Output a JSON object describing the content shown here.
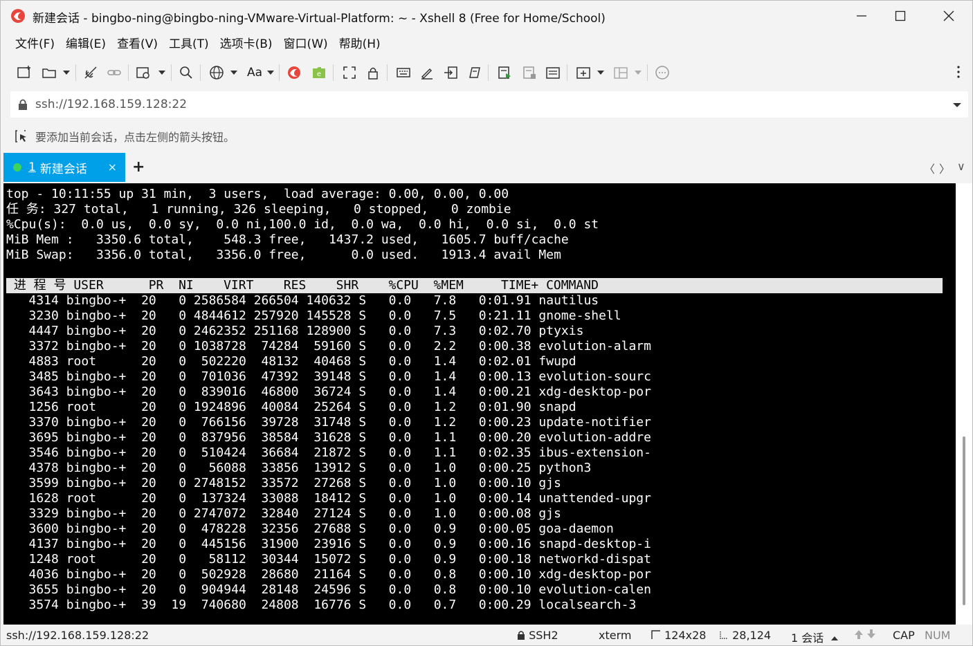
{
  "window": {
    "title": "新建会话 - bingbo-ning@bingbo-ning-VMware-Virtual-Platform: ~ - Xshell 8 (Free for Home/School)"
  },
  "menu": [
    "文件(F)",
    "编辑(E)",
    "查看(V)",
    "工具(T)",
    "选项卡(B)",
    "窗口(W)",
    "帮助(H)"
  ],
  "toolbar": {
    "font_label": "Aa"
  },
  "address": {
    "value": "ssh://192.168.159.128:22"
  },
  "hint": {
    "text": "要添加当前会话，点击左侧的箭头按钮。"
  },
  "tabs": [
    {
      "number": "1",
      "label": "新建会话",
      "close": "×"
    }
  ],
  "tab_add": "+",
  "tab_nav": {
    "prev": "〈",
    "next": "〉",
    "menu": "∨"
  },
  "terminal": {
    "summary": [
      "top - 10:11:55 up 31 min,  3 users,  load average: 0.00, 0.00, 0.00",
      "任 务: 327 total,   1 running, 326 sleeping,   0 stopped,   0 zombie",
      "%Cpu(s):  0.0 us,  0.0 sy,  0.0 ni,100.0 id,  0.0 wa,  0.0 hi,  0.0 si,  0.0 st",
      "MiB Mem :   3350.6 total,    548.3 free,   1437.2 used,   1605.7 buff/cache",
      "MiB Swap:   3356.0 total,   3356.0 free,      0.0 used.   1913.4 avail Mem"
    ],
    "header": " 进 程 号 USER      PR  NI    VIRT    RES    SHR    %CPU  %MEM     TIME+ COMMAND",
    "processes": [
      "   4314 bingbo-+  20   0 2586584 266504 140632 S   0.0   7.8   0:01.91 nautilus",
      "   3230 bingbo-+  20   0 4844612 257920 145528 S   0.0   7.5   0:21.11 gnome-shell",
      "   4447 bingbo-+  20   0 2462352 251168 128900 S   0.0   7.3   0:02.70 ptyxis",
      "   3372 bingbo-+  20   0 1038728  74284  59160 S   0.0   2.2   0:00.38 evolution-alarm",
      "   4883 root      20   0  502220  48132  40468 S   0.0   1.4   0:02.01 fwupd",
      "   3485 bingbo-+  20   0  701036  47392  39148 S   0.0   1.4   0:00.13 evolution-sourc",
      "   3643 bingbo-+  20   0  839016  46800  36724 S   0.0   1.4   0:00.21 xdg-desktop-por",
      "   1256 root      20   0 1924896  40084  25264 S   0.0   1.2   0:01.90 snapd",
      "   3370 bingbo-+  20   0  766156  39728  31748 S   0.0   1.2   0:00.23 update-notifier",
      "   3695 bingbo-+  20   0  837956  38584  31628 S   0.0   1.1   0:00.20 evolution-addre",
      "   3546 bingbo-+  20   0  510424  36684  21872 S   0.0   1.1   0:02.35 ibus-extension-",
      "   4378 bingbo-+  20   0   56088  33856  13912 S   0.0   1.0   0:00.25 python3",
      "   3599 bingbo-+  20   0 2748152  33572  27268 S   0.0   1.0   0:00.10 gjs",
      "   1628 root      20   0  137324  33088  18412 S   0.0   1.0   0:00.14 unattended-upgr",
      "   3329 bingbo-+  20   0 2747072  32840  27124 S   0.0   1.0   0:00.08 gjs",
      "   3600 bingbo-+  20   0  478228  32356  27688 S   0.0   0.9   0:00.05 goa-daemon",
      "   4137 bingbo-+  20   0  445156  31900  23916 S   0.0   0.9   0:00.16 snapd-desktop-i",
      "   1248 root      20   0   58112  30344  15072 S   0.0   0.9   0:00.18 networkd-dispat",
      "   4036 bingbo-+  20   0  502928  28680  21164 S   0.0   0.8   0:00.10 xdg-desktop-por",
      "   3655 bingbo-+  20   0  904944  28148  24596 S   0.0   0.8   0:00.10 evolution-calen",
      "   3574 bingbo-+  39  19  740680  24808  16776 S   0.0   0.7   0:00.29 localsearch-3"
    ]
  },
  "status": {
    "connection": "ssh://192.168.159.128:22",
    "protocol": "SSH2",
    "term_type": "xterm",
    "size": "124x28",
    "cursor": "28,124",
    "sessions": "1 会话",
    "cap": "CAP",
    "num": "NUM"
  },
  "colors": {
    "tab_active": "#00a0e9",
    "tab_dot": "#3dd35c",
    "terminal_bg": "#000000",
    "terminal_fg": "#ffffff",
    "header_bg": "#e5e5e5"
  }
}
